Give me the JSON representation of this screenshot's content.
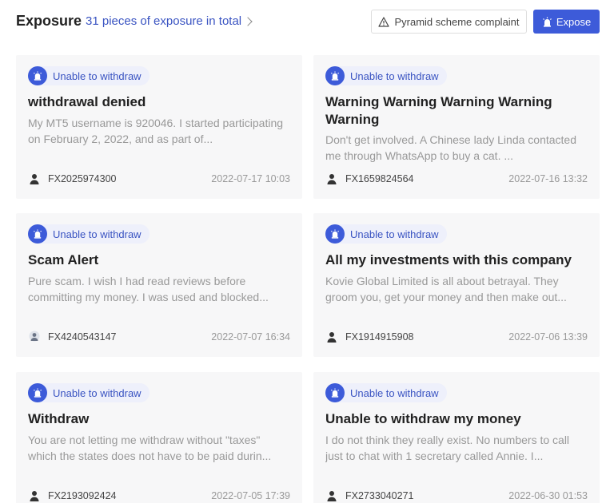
{
  "header": {
    "title": "Exposure",
    "total_link": "31 pieces of exposure in total",
    "complaint_button": "Pyramid scheme complaint",
    "expose_button": "Expose"
  },
  "colors": {
    "accent": "#3d5bd9",
    "tag_bg": "#eef0fb",
    "card_bg": "#f7f7f8"
  },
  "cards": [
    {
      "tag": "Unable to withdraw",
      "title": "withdrawal denied",
      "description": "My MT5 username is 920046. I started participating on February 2, 2022, and as part of...",
      "user": "FX2025974300",
      "date": "2022-07-17 10:03"
    },
    {
      "tag": "Unable to withdraw",
      "title": "Warning Warning Warning Warning Warning",
      "description": "Don't get involved. A Chinese lady Linda contacted me through WhatsApp to buy a cat. ...",
      "user": "FX1659824564",
      "date": "2022-07-16 13:32"
    },
    {
      "tag": "Unable to withdraw",
      "title": "Scam Alert",
      "description": "Pure scam. I wish I had read reviews before committing my money. I was used and blocked...",
      "user": "FX4240543147",
      "date": "2022-07-07 16:34"
    },
    {
      "tag": "Unable to withdraw",
      "title": "All my investments with this company",
      "description": "Kovie Global Limited is all about betrayal. They groom you, get your money and then make out...",
      "user": "FX1914915908",
      "date": "2022-07-06 13:39"
    },
    {
      "tag": "Unable to withdraw",
      "title": "Withdraw",
      "description": "You are not letting me withdraw without \"taxes\" which the states does not have to be paid durin...",
      "user": "FX2193092424",
      "date": "2022-07-05 17:39"
    },
    {
      "tag": "Unable to withdraw",
      "title": "Unable to withdraw my money",
      "description": "I do not think they really exist. No numbers to call just to chat with 1 secretary called Annie. I...",
      "user": "FX2733040271",
      "date": "2022-06-30 01:53"
    }
  ]
}
